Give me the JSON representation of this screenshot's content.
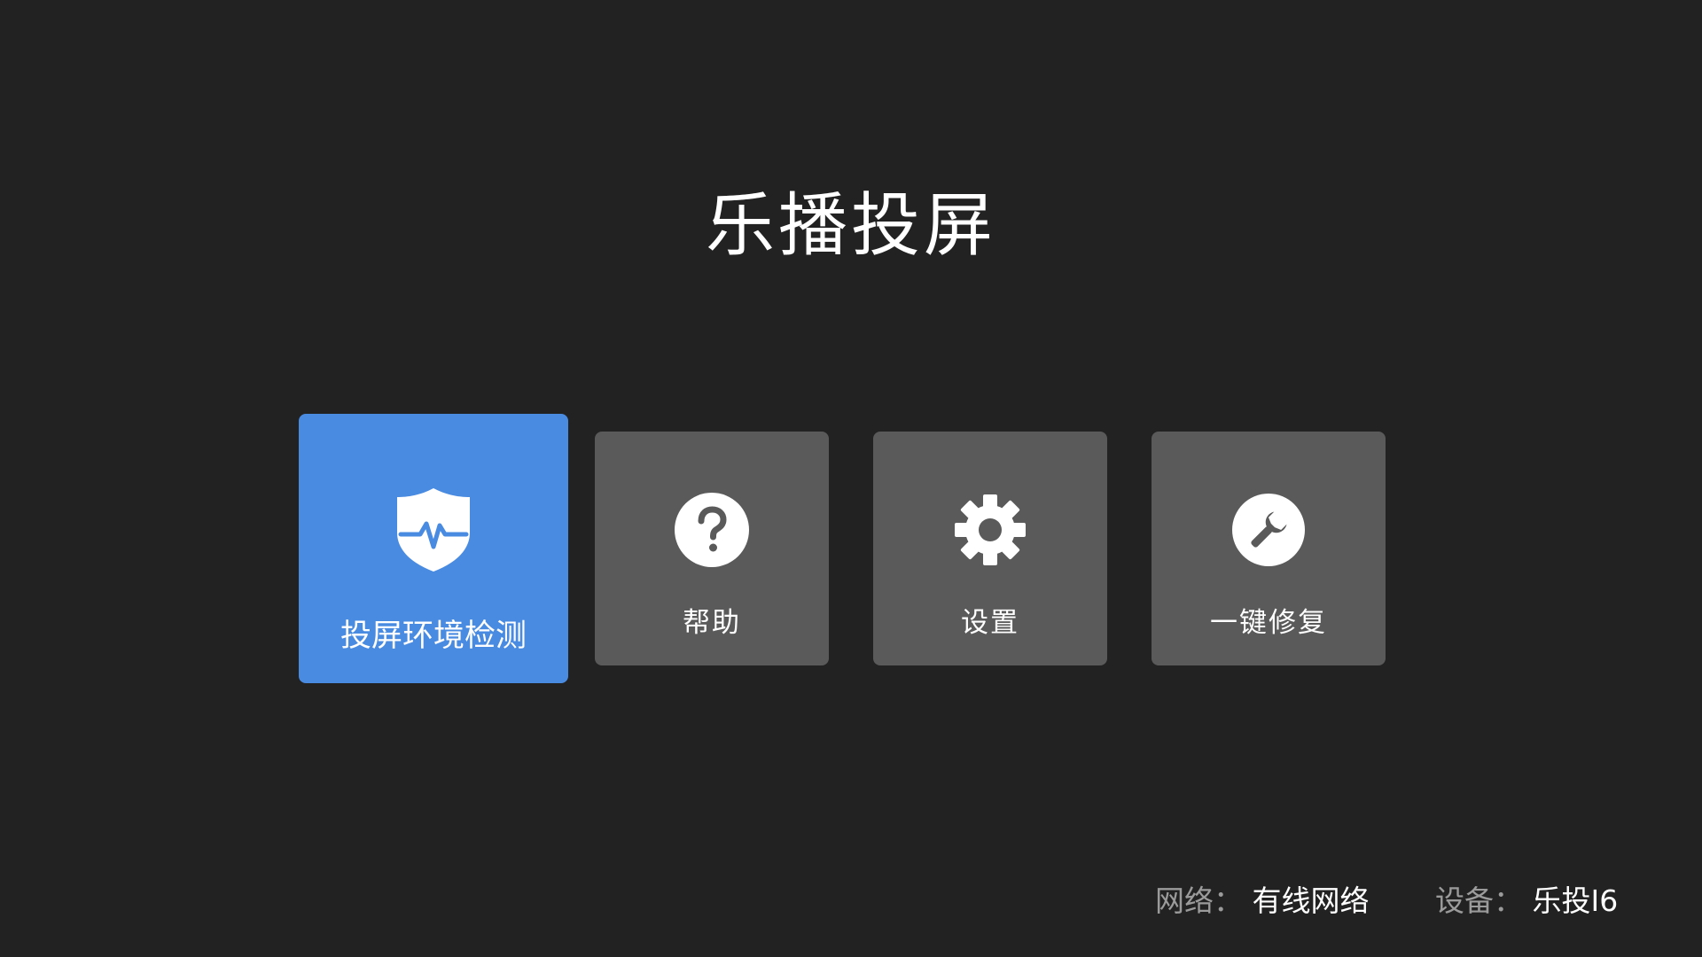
{
  "app": {
    "title": "乐播投屏"
  },
  "menu": {
    "items": [
      {
        "label": "投屏环境检测",
        "icon": "shield-pulse-icon",
        "focused": true
      },
      {
        "label": "帮助",
        "icon": "question-circle-icon",
        "focused": false
      },
      {
        "label": "设置",
        "icon": "gear-icon",
        "focused": false
      },
      {
        "label": "一键修复",
        "icon": "wrench-circle-icon",
        "focused": false
      }
    ]
  },
  "status": {
    "network_key": "网络：",
    "network_value": "有线网络",
    "device_key": "设备：",
    "device_value": "乐投I6"
  },
  "colors": {
    "background": "#232222",
    "tile": "#5a5a5a",
    "focused_tile": "#4a8be2",
    "secondary_text": "#9b9b9b"
  }
}
